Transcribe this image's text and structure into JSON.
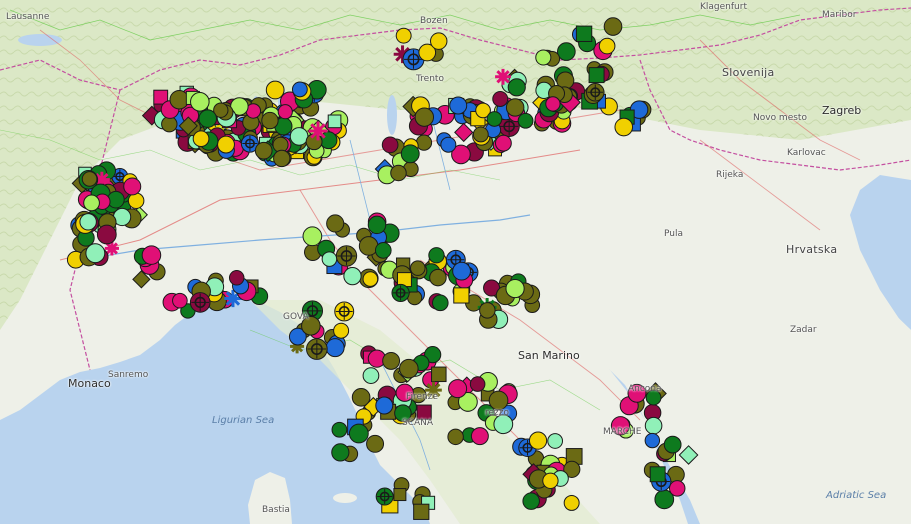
{
  "map": {
    "labels": [
      {
        "id": "lausanne",
        "text": "Lausanne",
        "kind": "p-small"
      },
      {
        "id": "bozen",
        "text": "Bozen",
        "kind": "p-small"
      },
      {
        "id": "klagenfurt",
        "text": "Klagenfurt",
        "kind": "p-small"
      },
      {
        "id": "maribor",
        "text": "Maribor",
        "kind": "p-small"
      },
      {
        "id": "slovenija",
        "text": "Slovenija",
        "kind": "p-country"
      },
      {
        "id": "zagreb",
        "text": "Zagreb",
        "kind": "p-city"
      },
      {
        "id": "trento",
        "text": "Trento",
        "kind": "p-small"
      },
      {
        "id": "novo-mesto",
        "text": "Novo mesto",
        "kind": "p-small"
      },
      {
        "id": "karlovac",
        "text": "Karlovac",
        "kind": "p-small"
      },
      {
        "id": "rijeka",
        "text": "Rijeka",
        "kind": "p-small"
      },
      {
        "id": "pula",
        "text": "Pula",
        "kind": "p-small"
      },
      {
        "id": "hrvatska",
        "text": "Hrvatska",
        "kind": "p-country"
      },
      {
        "id": "zadar",
        "text": "Zadar",
        "kind": "p-small"
      },
      {
        "id": "san-marino",
        "text": "San Marino",
        "kind": "p-city"
      },
      {
        "id": "monaco",
        "text": "Monaco",
        "kind": "p-city"
      },
      {
        "id": "ligurian-sea",
        "text": "Ligurian Sea",
        "kind": "p-sea"
      },
      {
        "id": "adriatic-sea",
        "text": "Adriatic Sea",
        "kind": "p-sea"
      },
      {
        "id": "marche",
        "text": "MARCHE",
        "kind": "p-small"
      },
      {
        "id": "bastia",
        "text": "Bastia",
        "kind": "p-small"
      },
      {
        "id": "genova",
        "text": "GOVA",
        "kind": "p-small"
      },
      {
        "id": "firenze",
        "text": "Firenze",
        "kind": "p-small"
      },
      {
        "id": "arezzo",
        "text": "rezzo",
        "kind": "p-small"
      },
      {
        "id": "toscana",
        "text": "SCANA",
        "kind": "p-small"
      },
      {
        "id": "ancona",
        "text": "Ancona",
        "kind": "p-small"
      },
      {
        "id": "sanremo",
        "text": "Sanremo",
        "kind": "p-small"
      }
    ],
    "colors": {
      "sea": "#b9d3ee",
      "land": "#eef0e8",
      "hills": "#d9e6c4",
      "border": "#c44fa0",
      "road": "#e06060",
      "outline": "#1a1a1a",
      "olive": "#6b6a14",
      "darkgreen": "#0e7a1e",
      "magenta": "#e01076",
      "maroon": "#8a0a40",
      "lime": "#a8f060",
      "yellow": "#f0d000",
      "blue": "#1e6ad8",
      "mint": "#90f0b8"
    },
    "marker_types": [
      "circle",
      "square",
      "diamond",
      "ring-target",
      "asterisk"
    ]
  }
}
